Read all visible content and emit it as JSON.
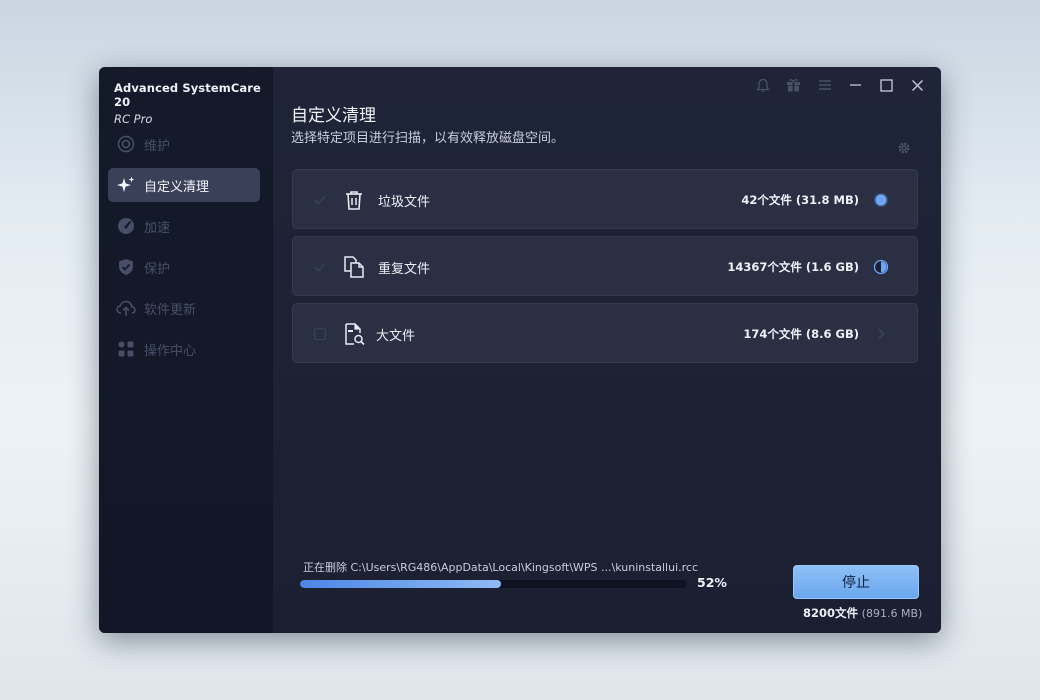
{
  "app": {
    "name": "Advanced SystemCare 20",
    "edition": "RC Pro"
  },
  "sidebar": {
    "items": [
      {
        "label": "维护",
        "icon": "maintenance-icon",
        "active": false
      },
      {
        "label": "自定义清理",
        "icon": "sparkle-icon",
        "active": true
      },
      {
        "label": "加速",
        "icon": "speedometer-icon",
        "active": false
      },
      {
        "label": "保护",
        "icon": "shield-icon",
        "active": false
      },
      {
        "label": "软件更新",
        "icon": "cloud-upload-icon",
        "active": false
      },
      {
        "label": "操作中心",
        "icon": "grid-icon",
        "active": false
      }
    ]
  },
  "titlebar": {
    "icons": [
      "bell-icon",
      "gift-icon",
      "menu-icon",
      "minimize-icon",
      "maximize-icon",
      "close-icon"
    ]
  },
  "main": {
    "title": "自定义清理",
    "subtitle": "选择特定项目进行扫描，以有效释放磁盘空间。",
    "cards": [
      {
        "label": "垃圾文件",
        "count": "42个文件 (31.8 MB)",
        "icon": "trash-icon",
        "state": "done"
      },
      {
        "label": "重复文件",
        "count": "14367个文件 (1.6 GB)",
        "icon": "duplicate-files-icon",
        "state": "in-progress"
      },
      {
        "label": "大文件",
        "count": "174个文件 (8.6 GB)",
        "icon": "file-search-icon",
        "state": "pending"
      }
    ]
  },
  "progress": {
    "status_prefix": "正在删除",
    "path": "C:\\Users\\RG486\\AppData\\Local\\Kingsoft\\WPS ...\\kuninstallui.rcc",
    "percent": 52,
    "percent_label": "52%"
  },
  "footer": {
    "stop_label": "停止",
    "file_count": "8200文件",
    "size": "(891.6 MB)"
  },
  "colors": {
    "accent": "#6aa6ee",
    "progress": "#4c86e6",
    "background": "#1b2033",
    "sidebar": "#151a2b"
  }
}
